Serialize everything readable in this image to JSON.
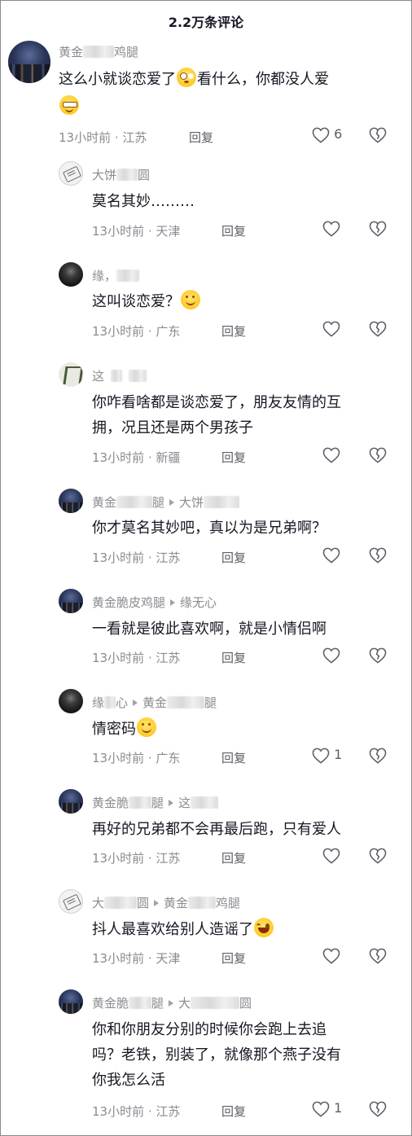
{
  "header": {
    "title": "2.2万条评论"
  },
  "comments": [
    {
      "name_prefix": "黄金",
      "name_suffix": "鸡腿",
      "text_lines": [
        "这么小就谈恋爱了",
        "看什么，你都没人爱"
      ],
      "time": "13小时前",
      "location": "江苏",
      "reply": "回复",
      "likes": "6"
    },
    {
      "name_prefix": "大饼",
      "name_suffix": "圆",
      "text": "莫名其妙………",
      "time": "13小时前",
      "location": "天津",
      "reply": "回复",
      "likes": ""
    },
    {
      "name_prefix": "缘，",
      "name_suffix": "",
      "text": "这叫谈恋爱？",
      "time": "13小时前",
      "location": "广东",
      "reply": "回复",
      "likes": ""
    },
    {
      "name_prefix": "这",
      "name_suffix": "",
      "text_lines": [
        "你咋看啥都是谈恋爱了，朋友友情的互",
        "拥，况且还是两个男孩子"
      ],
      "time": "13小时前",
      "location": "新疆",
      "reply": "回复",
      "likes": ""
    },
    {
      "name_prefix": "黄金",
      "name_suffix": "腿",
      "reply_to_prefix": "大饼",
      "reply_to_suffix": "",
      "text": "你才莫名其妙吧，真以为是兄弟啊？",
      "time": "13小时前",
      "location": "江苏",
      "reply": "回复",
      "likes": ""
    },
    {
      "name": "黄金脆皮鸡腿",
      "reply_to": "缘无心",
      "text": "一看就是彼此喜欢啊，就是小情侣啊",
      "time": "13小时前",
      "location": "江苏",
      "reply": "回复",
      "likes": ""
    },
    {
      "name_prefix": "缘",
      "name_suffix": "心",
      "reply_to_prefix": "黄金",
      "reply_to_suffix": "腿",
      "text": "情密码",
      "time": "13小时前",
      "location": "广东",
      "reply": "回复",
      "likes": "1"
    },
    {
      "name_prefix": "黄金脆",
      "name_suffix": "腿",
      "reply_to_prefix": "这",
      "reply_to_suffix": "",
      "text": "再好的兄弟都不会再最后跑，只有爱人",
      "time": "13小时前",
      "location": "江苏",
      "reply": "回复",
      "likes": ""
    },
    {
      "name_prefix": "大",
      "name_suffix": "圆",
      "reply_to_prefix": "黄金",
      "reply_to_suffix": "鸡腿",
      "text": "抖人最喜欢给别人造谣了",
      "time": "13小时前",
      "location": "天津",
      "reply": "回复",
      "likes": ""
    },
    {
      "name_prefix": "黄金脆",
      "name_suffix": "腿",
      "reply_to_prefix": "大",
      "reply_to_suffix": "圆",
      "text_lines": [
        "你和你朋友分别的时候你会跑上去追",
        "吗？老铁，别装了，就像那个燕子没有",
        "你我怎么活"
      ],
      "time": "13小时前",
      "location": "江苏",
      "reply": "回复",
      "likes": "1"
    }
  ],
  "separator": " · ",
  "colors": {
    "text": "#161823",
    "meta": "#8a8b91",
    "action": "#5c5e66"
  },
  "icons": {
    "like": "heart-outline-icon",
    "dislike": "broken-heart-icon",
    "reply_arrow": "triangle-right-icon"
  }
}
